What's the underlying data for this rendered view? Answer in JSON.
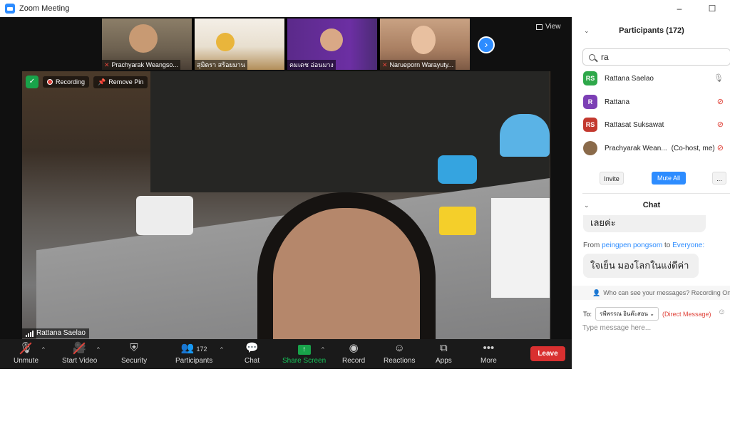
{
  "window": {
    "title": "Zoom Meeting",
    "minimize": "–",
    "maximize": "☐"
  },
  "strip": {
    "thumbs": [
      {
        "name": "Prachyarak Weangso...",
        "muted": true
      },
      {
        "name": "สุมิตรา  สร้อยมาน",
        "muted": false
      },
      {
        "name": "คมเดช อ่อนมาง",
        "muted": false
      },
      {
        "name": "Narueporn Warayuty...",
        "muted": true
      }
    ],
    "next": "›",
    "view_label": "View"
  },
  "main": {
    "recording": "Recording",
    "remove_pin": "Remove Pin",
    "speaker": "Rattana Saelao"
  },
  "toolbar": {
    "unmute": "Unmute",
    "start_video": "Start Video",
    "security": "Security",
    "participants": "Participants",
    "participants_count": "172",
    "chat": "Chat",
    "share_screen": "Share Screen",
    "record": "Record",
    "reactions": "Reactions",
    "apps": "Apps",
    "more": "More",
    "leave": "Leave"
  },
  "participants": {
    "title": "Participants (172)",
    "search_value": "ra",
    "list": [
      {
        "initials": "RS",
        "name": "Rattana Saelao",
        "status": "",
        "color": "#2ea84a",
        "muted": false
      },
      {
        "initials": "R",
        "name": "Rattana",
        "status": "",
        "color": "#7c3fb5",
        "muted": true
      },
      {
        "initials": "RS",
        "name": "Rattasat Suksawat",
        "status": "",
        "color": "#c3392f",
        "muted": true
      },
      {
        "initials": "",
        "name": "Prachyarak Wean...",
        "status": "(Co-host, me)",
        "color": "#8a6a4a",
        "muted": true
      }
    ],
    "invite": "Invite",
    "mute_all": "Mute All",
    "more": "..."
  },
  "chat": {
    "title": "Chat",
    "prev_msg": "เลยค่ะ",
    "from_prefix": "From",
    "from_name": "peingpen pongsom",
    "to_word": "to",
    "to_target": "Everyone:",
    "message": "ใจเย็น มองโลกในแง่ดีค่า",
    "who_can_see": "Who can see your messages? Recording On",
    "to_label": "To:",
    "to_select": "รพีพรรณ อินต๊ะสอน",
    "direct": "(Direct Message)",
    "placeholder": "Type message here..."
  },
  "colors": {
    "accent": "#2d8cff",
    "leave": "#d93030",
    "share": "#18a34a"
  }
}
